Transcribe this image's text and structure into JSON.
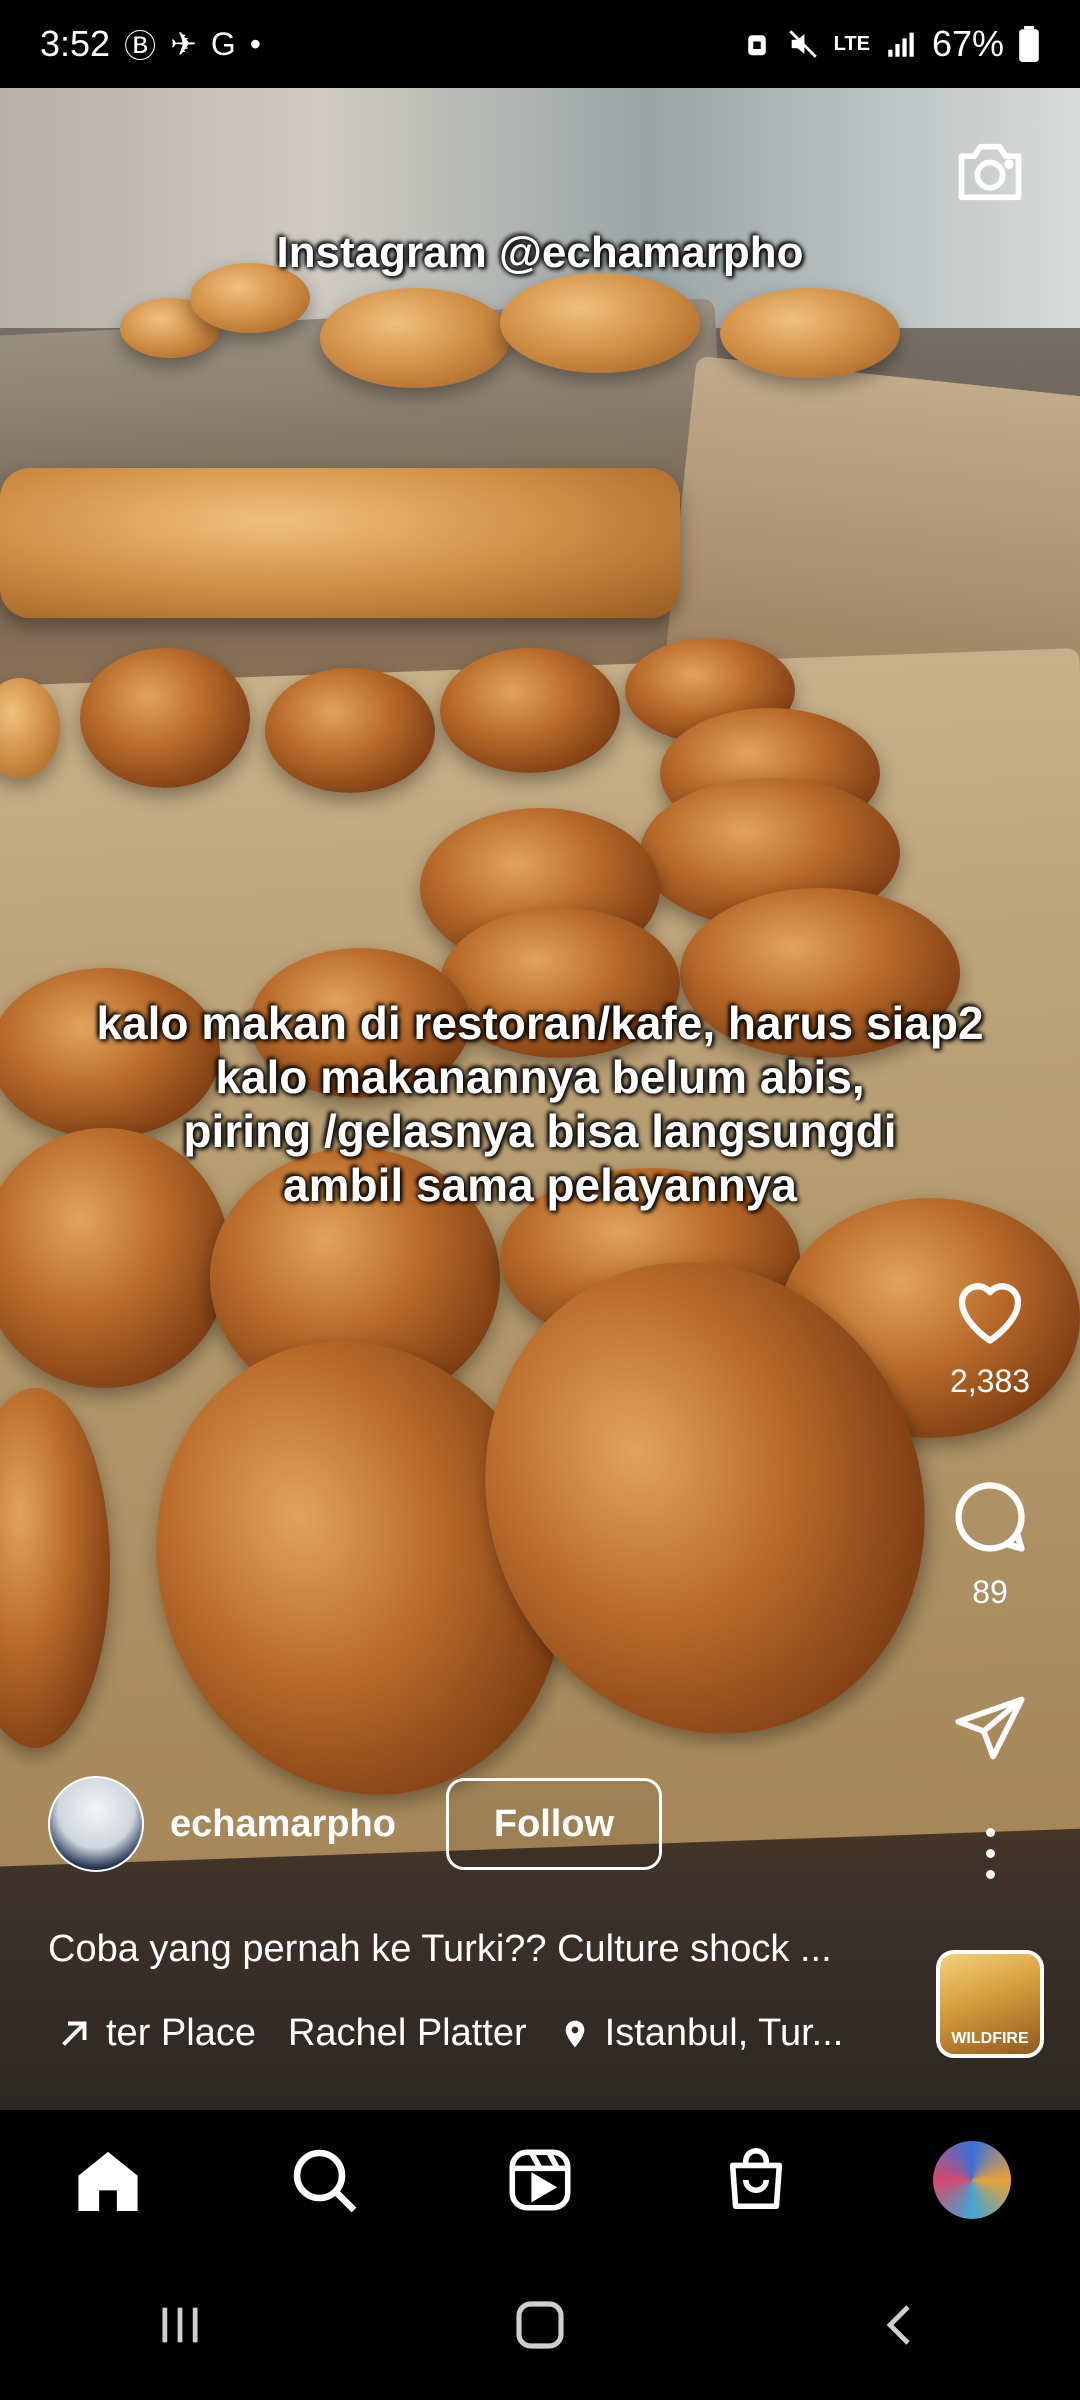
{
  "status_bar": {
    "time": "3:52",
    "left_icons": [
      "Ⓑ",
      "✈",
      "G",
      "•"
    ],
    "network": "LTE",
    "battery": "67%"
  },
  "video": {
    "watermark": "Instagram @echamarpho",
    "overlay_caption_lines": [
      "kalo makan di restoran/kafe, harus siap2",
      "kalo makanannya belum abis,",
      "piring /gelasnya bisa langsungdi",
      "ambil sama pelayannya"
    ]
  },
  "actions": {
    "likes": "2,383",
    "comments": "89"
  },
  "post": {
    "username": "echamarpho",
    "follow_label": "Follow",
    "caption": "Coba yang pernah ke Turki?? Culture shock ...",
    "audio_segment_1": "ter Place",
    "audio_segment_2": "Rachel Platter",
    "location": "Istanbul, Tur...",
    "audio_thumb_text": "WILDFIRE"
  },
  "icons": {
    "camera": "camera-icon",
    "like": "heart-icon",
    "comment": "comment-icon",
    "share": "send-icon",
    "more": "more-icon",
    "home": "home-icon",
    "search": "search-icon",
    "reels": "reels-icon",
    "shop": "shop-icon"
  }
}
